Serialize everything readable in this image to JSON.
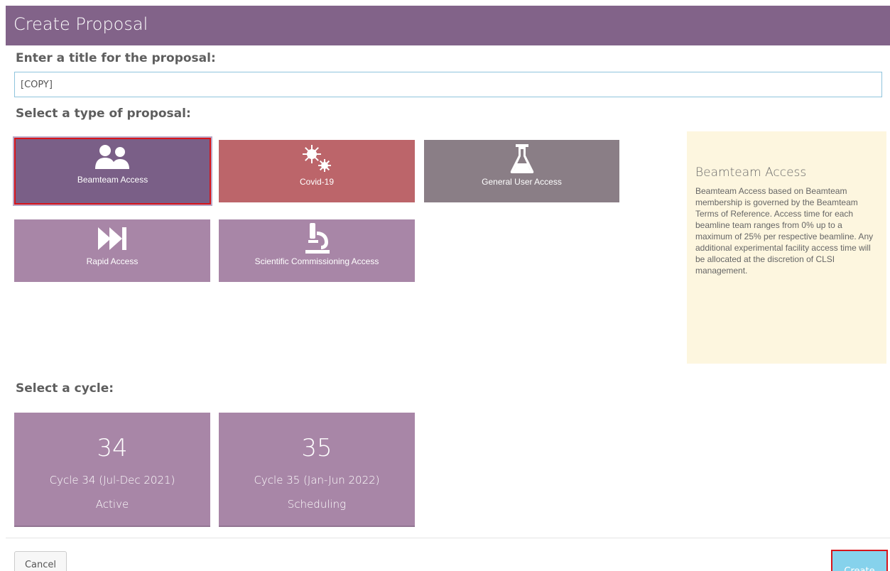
{
  "header": {
    "title": "Create Proposal"
  },
  "title_section": {
    "label": "Enter a title for the proposal:",
    "input_value": "[COPY]"
  },
  "type_section": {
    "label": "Select a type of proposal:",
    "types": [
      {
        "label": "Beamteam Access",
        "icon": "users-icon",
        "color": "#7a5f87",
        "selected": true
      },
      {
        "label": "Covid-19",
        "icon": "virus-icon",
        "color": "#bc656a"
      },
      {
        "label": "General User Access",
        "icon": "flask-icon",
        "color": "#8a7e86"
      },
      {
        "label": "Rapid Access",
        "icon": "fast-forward-icon",
        "color": "#a886a7"
      },
      {
        "label": "Scientific Commissioning Access",
        "icon": "microscope-icon",
        "color": "#a886a7"
      }
    ]
  },
  "info_panel": {
    "title": "Beamteam Access",
    "text": "Beamteam Access based on Beamteam membership is governed by the Beamteam Terms of Reference. Access time for each beamline team ranges from 0% up to a maximum of 25% per respective beamline. Any additional experimental facility access time will be allocated at the discretion of CLSI management."
  },
  "cycle_section": {
    "label": "Select a cycle:",
    "cycles": [
      {
        "number": "34",
        "name": "Cycle 34 (Jul-Dec 2021)",
        "status": "Active"
      },
      {
        "number": "35",
        "name": "Cycle 35 (Jan-Jun 2022)",
        "status": "Scheduling"
      }
    ]
  },
  "footer": {
    "cancel_label": "Cancel",
    "create_label": "Create"
  },
  "colors": {
    "header": "#826389",
    "tile": "#a886a7",
    "info_bg": "#fdf6df",
    "create": "#86d2ec",
    "selected_border": "#d7141a"
  }
}
